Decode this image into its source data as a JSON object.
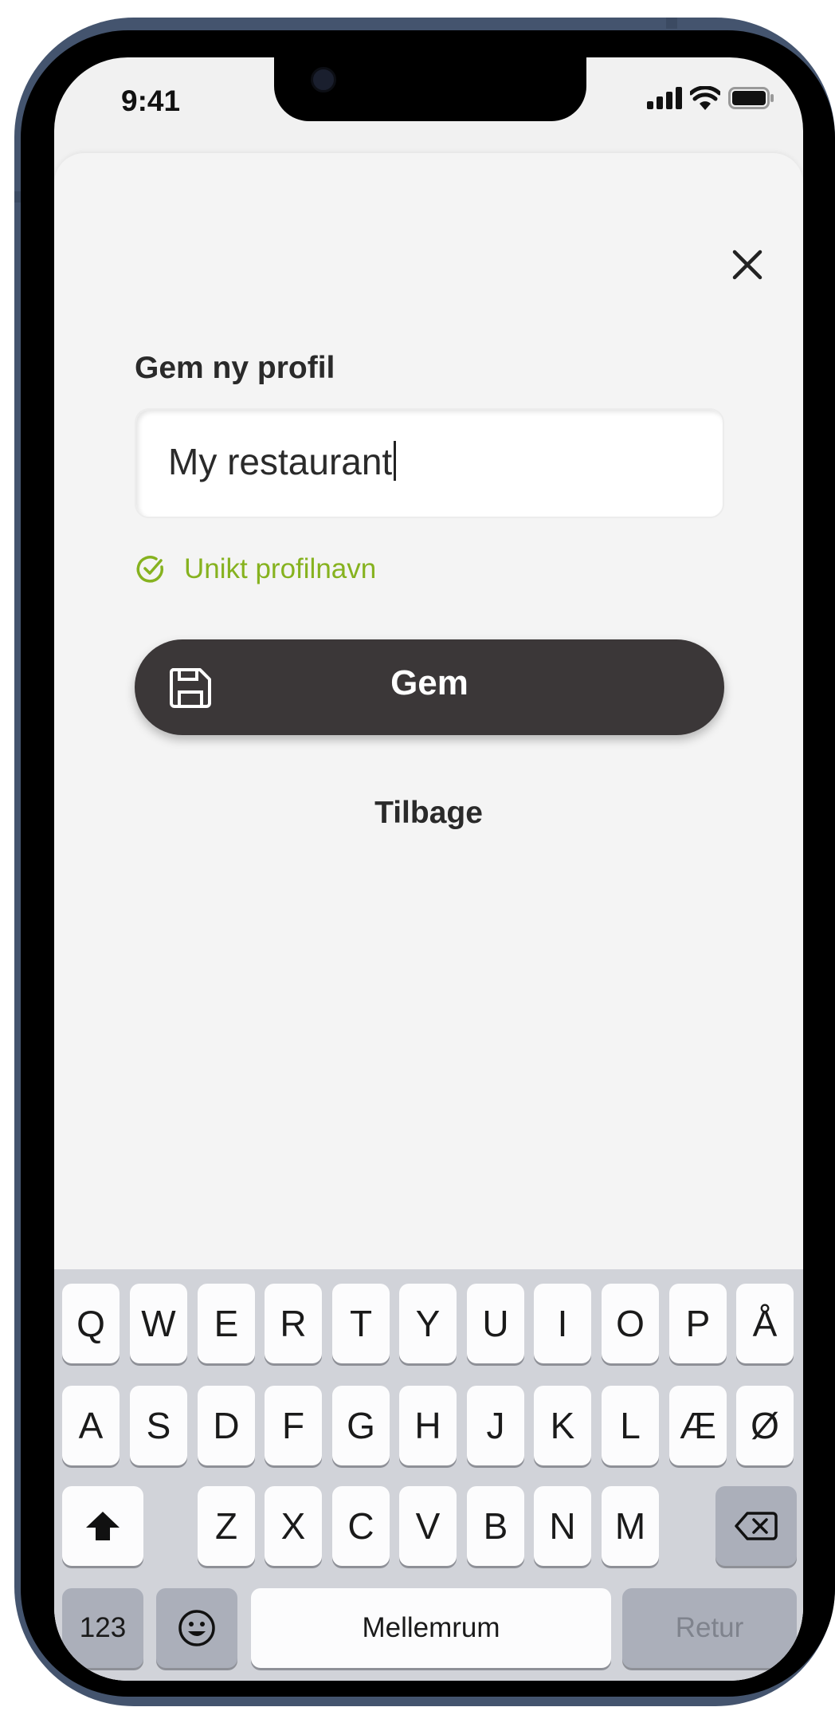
{
  "status_bar": {
    "time": "9:41",
    "icons": [
      "signal-icon",
      "wifi-icon",
      "battery-icon"
    ]
  },
  "sheet": {
    "close_icon": "close-icon",
    "title": "Gem ny profil",
    "input": {
      "value": "My restaurant",
      "placeholder": ""
    },
    "validation": {
      "icon": "check-circle-icon",
      "text": "Unikt profilnavn",
      "color": "#86b21f"
    },
    "save_button": {
      "icon": "floppy-disk-icon",
      "label": "Gem"
    },
    "back_link": "Tilbage"
  },
  "keyboard": {
    "row1": [
      "Q",
      "W",
      "E",
      "R",
      "T",
      "Y",
      "U",
      "I",
      "O",
      "P",
      "Å"
    ],
    "row2": [
      "A",
      "S",
      "D",
      "F",
      "G",
      "H",
      "J",
      "K",
      "L",
      "Æ",
      "Ø"
    ],
    "row3": [
      "Z",
      "X",
      "C",
      "V",
      "B",
      "N",
      "M"
    ],
    "shift_icon": "shift-icon",
    "backspace_icon": "backspace-icon",
    "numbers_label": "123",
    "emoji_icon": "emoji-icon",
    "space_label": "Mellemrum",
    "return_label": "Retur"
  },
  "colors": {
    "button_dark": "#3b3738",
    "success_green": "#86b21f",
    "frame_blue": "#44546e"
  }
}
